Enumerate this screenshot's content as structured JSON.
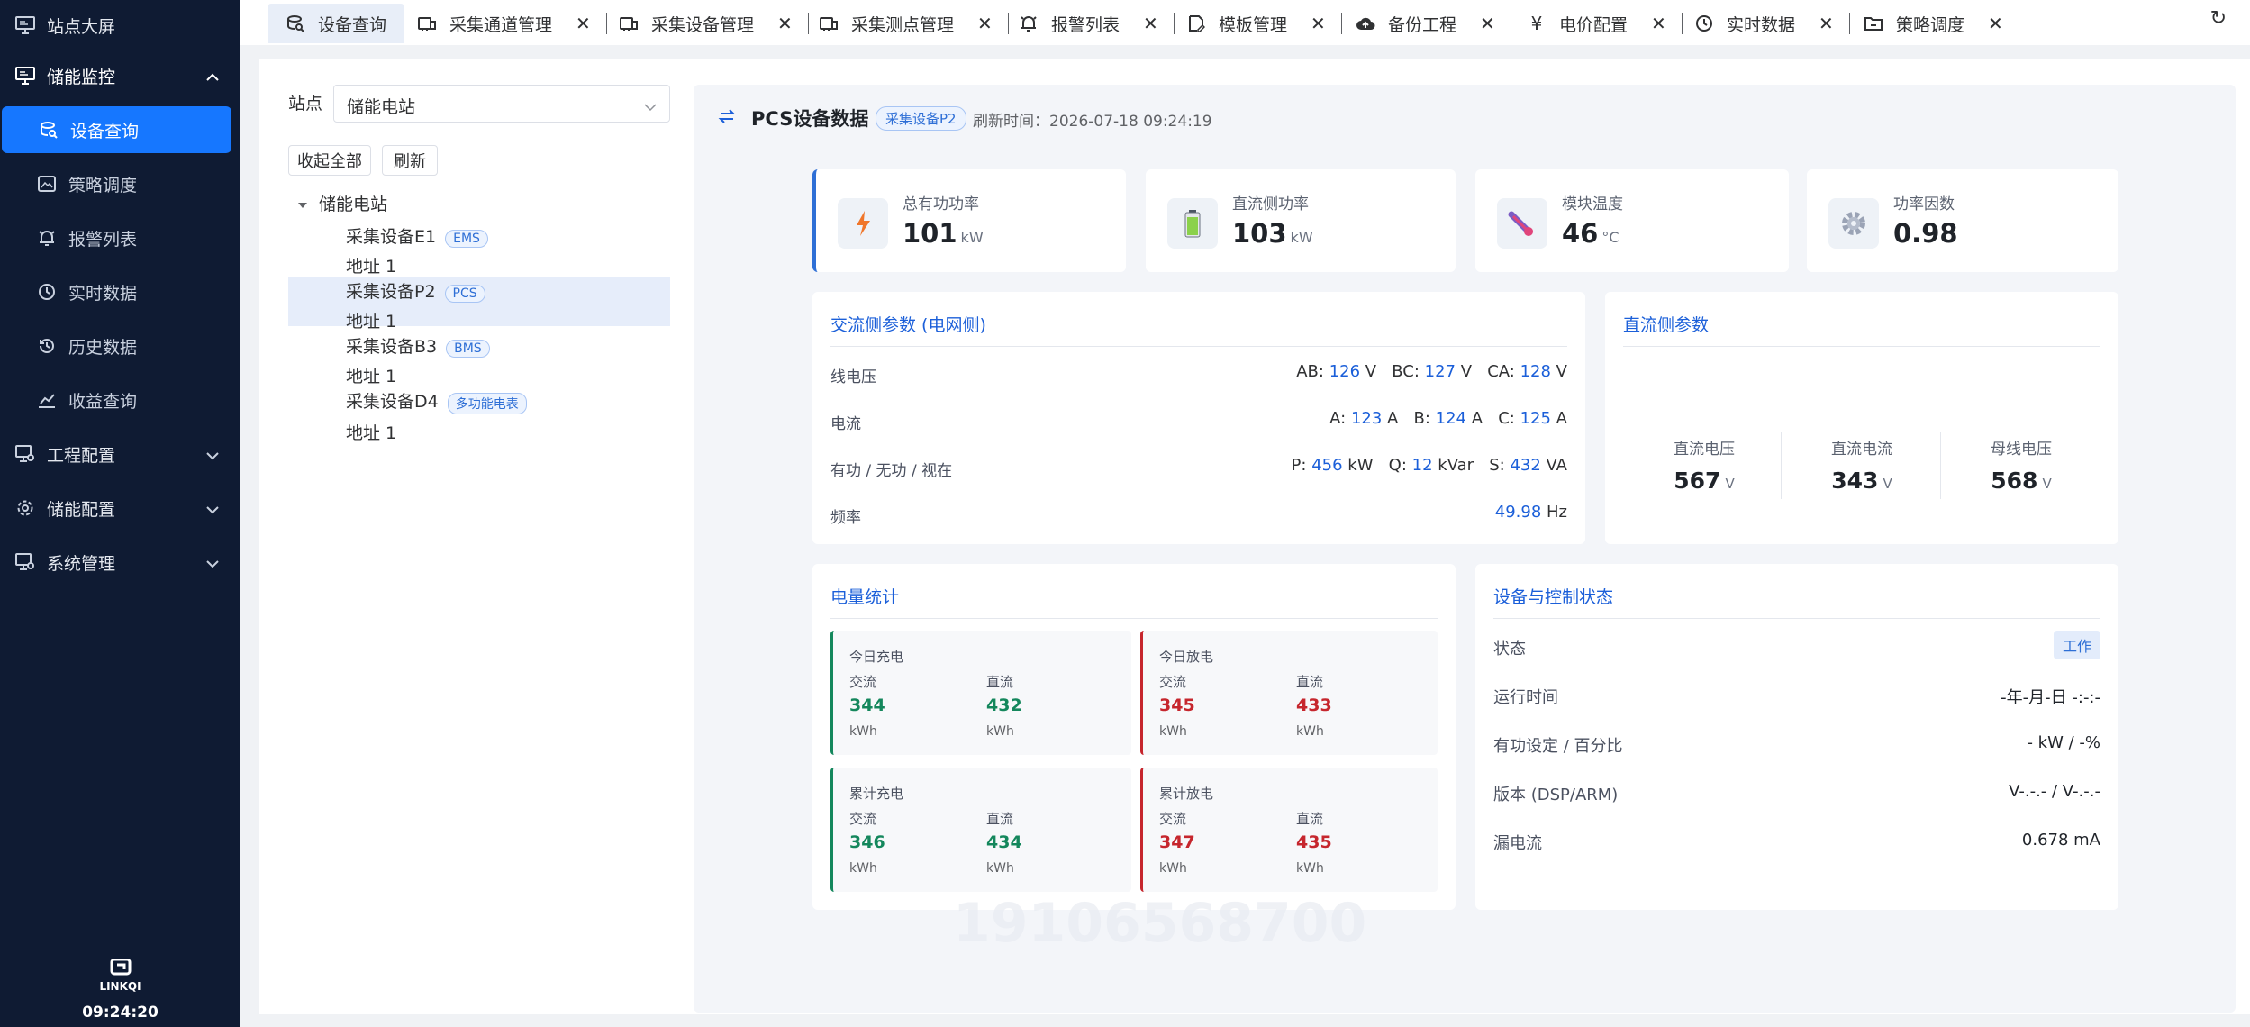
{
  "sidebar": {
    "items": [
      {
        "label": "站点大屏"
      },
      {
        "label": "储能监控"
      },
      {
        "label": "设备查询"
      },
      {
        "label": "策略调度"
      },
      {
        "label": "报警列表"
      },
      {
        "label": "实时数据"
      },
      {
        "label": "历史数据"
      },
      {
        "label": "收益查询"
      },
      {
        "label": "工程配置"
      },
      {
        "label": "储能配置"
      },
      {
        "label": "系统管理"
      }
    ],
    "logo_text": "LINKQI",
    "clock": "09:24:20"
  },
  "tabs": [
    {
      "label": "设备查询",
      "icon": "device-query-icon"
    },
    {
      "label": "采集通道管理",
      "icon": "channel-icon"
    },
    {
      "label": "采集设备管理",
      "icon": "device-icon"
    },
    {
      "label": "采集测点管理",
      "icon": "measure-point-icon"
    },
    {
      "label": "报警列表",
      "icon": "alarm-icon"
    },
    {
      "label": "模板管理",
      "icon": "template-icon"
    },
    {
      "label": "备份工程",
      "icon": "cloud-upload-icon"
    },
    {
      "label": "电价配置",
      "icon": "yen-icon"
    },
    {
      "label": "实时数据",
      "icon": "clock-icon"
    },
    {
      "label": "策略调度",
      "icon": "folder-icon"
    }
  ],
  "site": {
    "label": "站点",
    "selected": "储能电站",
    "collapse_label": "收起全部",
    "refresh_label": "刷新"
  },
  "tree": {
    "root": "储能电站",
    "devices": [
      {
        "name": "采集设备E1",
        "tag": "EMS",
        "addr": "地址 1"
      },
      {
        "name": "采集设备P2",
        "tag": "PCS",
        "addr": "地址 1"
      },
      {
        "name": "采集设备B3",
        "tag": "BMS",
        "addr": "地址 1"
      },
      {
        "name": "采集设备D4",
        "tag": "多功能电表",
        "addr": "地址 1"
      }
    ]
  },
  "main": {
    "title": "PCS设备数据",
    "device_tag": "采集设备P2",
    "refresh_time": "刷新时间：2026-07-18 09:24:19",
    "stats": [
      {
        "label": "总有功功率",
        "value": "101",
        "unit": "kW",
        "icon": "lightning-icon"
      },
      {
        "label": "直流侧功率",
        "value": "103",
        "unit": "kW",
        "icon": "battery-icon"
      },
      {
        "label": "模块温度",
        "value": "46",
        "unit": "°C",
        "icon": "thermometer-icon"
      },
      {
        "label": "功率因数",
        "value": "0.98",
        "unit": "",
        "icon": "gear-icon"
      }
    ],
    "ac": {
      "title": "交流侧参数 (电网侧)",
      "rows": [
        {
          "label": "线电压",
          "parts": [
            [
              "AB: ",
              "126",
              " V"
            ],
            [
              "BC: ",
              "127",
              " V"
            ],
            [
              "CA: ",
              "128",
              " V"
            ]
          ]
        },
        {
          "label": "电流",
          "parts": [
            [
              "A: ",
              "123",
              " A"
            ],
            [
              "B: ",
              "124",
              " A"
            ],
            [
              "C: ",
              "125",
              " A"
            ]
          ]
        },
        {
          "label": "有功 / 无功 / 视在",
          "parts": [
            [
              "P: ",
              "456",
              " kW"
            ],
            [
              "Q: ",
              "12",
              " kVar"
            ],
            [
              "S: ",
              "432",
              " VA"
            ]
          ]
        },
        {
          "label": "频率",
          "parts": [
            [
              "",
              "49.98",
              " Hz"
            ]
          ]
        }
      ]
    },
    "dc": {
      "title": "直流侧参数",
      "items": [
        {
          "label": "直流电压",
          "value": "567",
          "unit": "V"
        },
        {
          "label": "直流电流",
          "value": "343",
          "unit": "V"
        },
        {
          "label": "母线电压",
          "value": "568",
          "unit": "V"
        }
      ]
    },
    "energy": {
      "title": "电量统计",
      "boxes": [
        {
          "title": "今日充电",
          "ac_label": "交流",
          "dc_label": "直流",
          "ac": "344",
          "dc": "432",
          "unit": "kWh"
        },
        {
          "title": "今日放电",
          "ac_label": "交流",
          "dc_label": "直流",
          "ac": "345",
          "dc": "433",
          "unit": "kWh"
        },
        {
          "title": "累计充电",
          "ac_label": "交流",
          "dc_label": "直流",
          "ac": "346",
          "dc": "434",
          "unit": "kWh"
        },
        {
          "title": "累计放电",
          "ac_label": "交流",
          "dc_label": "直流",
          "ac": "347",
          "dc": "435",
          "unit": "kWh"
        }
      ]
    },
    "status": {
      "title": "设备与控制状态",
      "rows": [
        {
          "label": "状态",
          "value": "工作"
        },
        {
          "label": "运行时间",
          "value": "-年-月-日 -:-:-"
        },
        {
          "label": "有功设定 / 百分比",
          "value": "- kW / -%"
        },
        {
          "label": "版本 (DSP/ARM)",
          "value": "V-.-.- / V-.-.-"
        },
        {
          "label": "漏电流",
          "value": "0.678 mA"
        }
      ]
    },
    "watermark": "19106568700"
  },
  "colors": {
    "accent": "#1677ff",
    "sidebar_bg": "#0f1b33",
    "charge": "#14875c",
    "discharge": "#c6262d"
  }
}
